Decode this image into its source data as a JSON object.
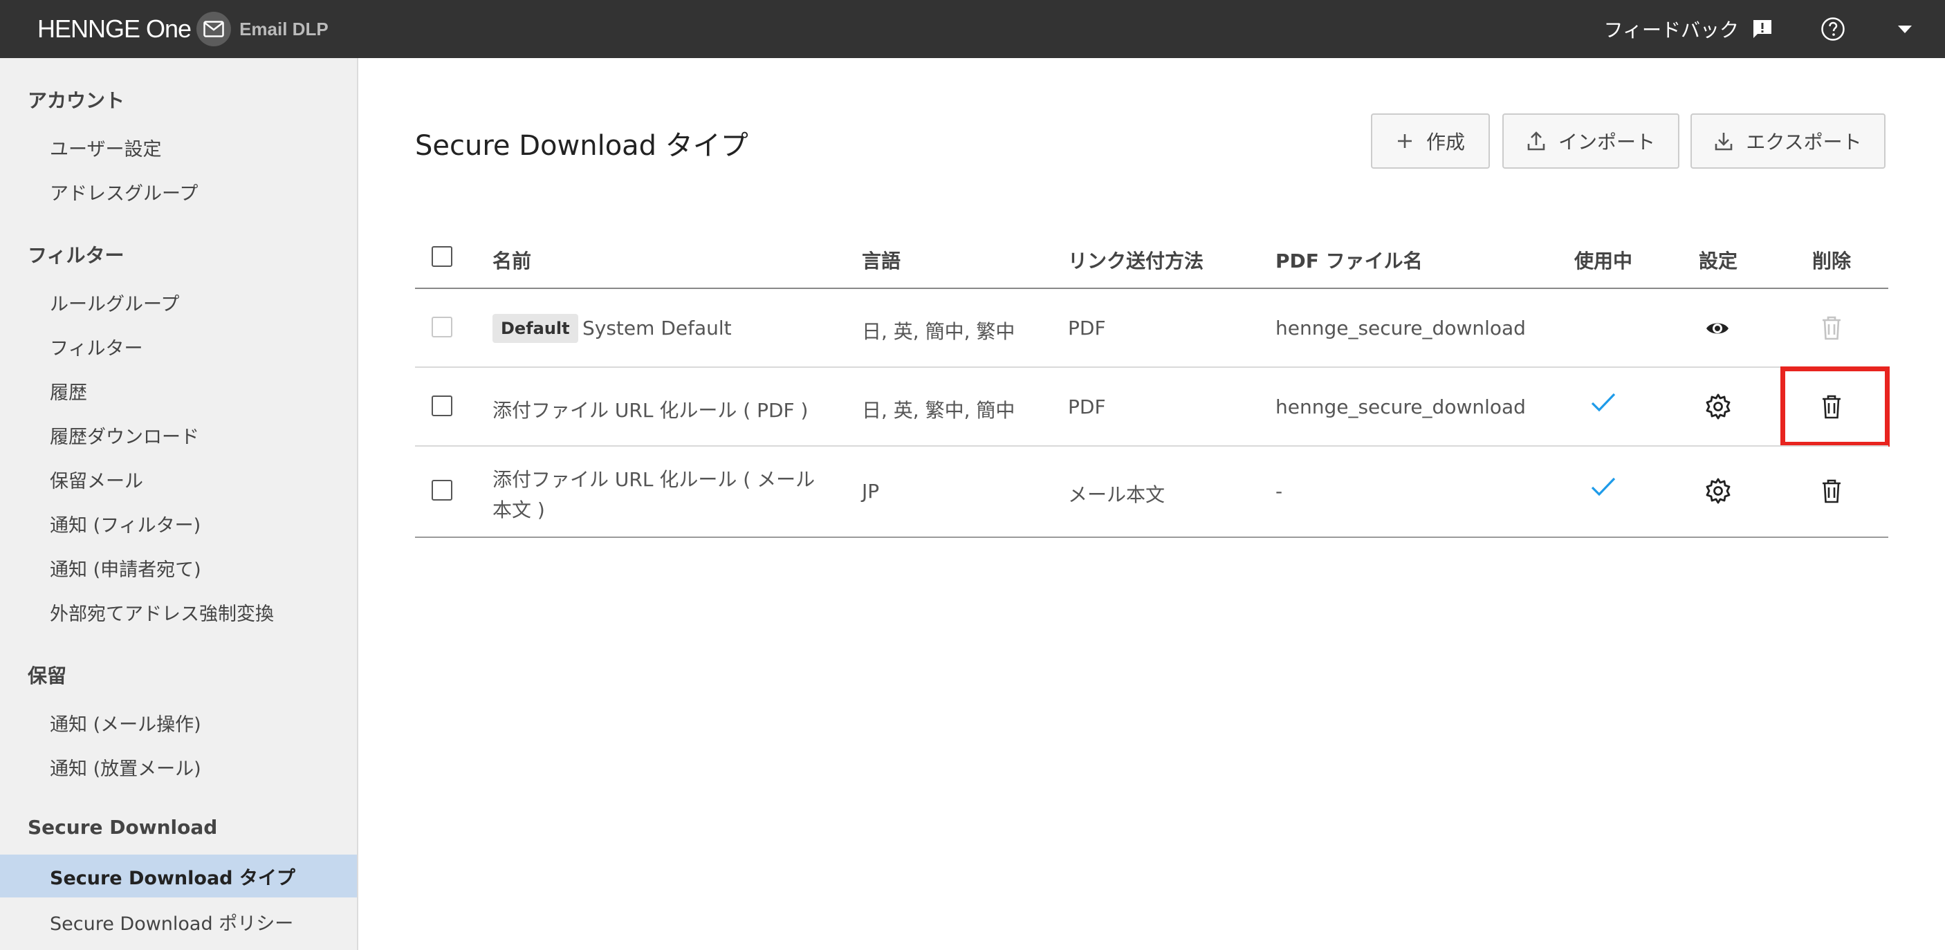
{
  "topbar": {
    "brand": "HENNGE One",
    "product": "Email DLP",
    "feedback_label": "フィードバック",
    "icons": [
      "feedback-icon",
      "help-icon",
      "caret-down-icon"
    ]
  },
  "sidebar": {
    "sections": [
      {
        "title": "アカウント",
        "items": [
          "ユーザー設定",
          "アドレスグループ"
        ]
      },
      {
        "title": "フィルター",
        "items": [
          "ルールグループ",
          "フィルター",
          "履歴",
          "履歴ダウンロード",
          "保留メール",
          "通知 (フィルター)",
          "通知 (申請者宛て)",
          "外部宛てアドレス強制変換"
        ]
      },
      {
        "title": "保留",
        "items": [
          "通知 (メール操作)",
          "通知 (放置メール)"
        ]
      },
      {
        "title": "Secure Download",
        "items": [
          "Secure Download タイプ",
          "Secure Download ポリシー"
        ]
      }
    ],
    "active_item": "Secure Download タイプ"
  },
  "main": {
    "title": "Secure Download タイプ",
    "buttons": {
      "create": "作成",
      "import": "インポート",
      "export": "エクスポート"
    },
    "table": {
      "headers": {
        "name": "名前",
        "language": "言語",
        "link_method": "リンク送付方法",
        "pdf_filename": "PDF ファイル名",
        "in_use": "使用中",
        "settings": "設定",
        "delete": "削除"
      },
      "rows": [
        {
          "badge": "Default",
          "name": "System Default",
          "language": "日, 英, 簡中, 繁中",
          "link_method": "PDF",
          "pdf_filename": "hennge_secure_download",
          "in_use": false,
          "settings_icon": "eye-icon",
          "delete_enabled": false
        },
        {
          "badge": "",
          "name": "添付ファイル URL 化ルール ( PDF )",
          "language": "日, 英, 繁中, 簡中",
          "link_method": "PDF",
          "pdf_filename": "hennge_secure_download",
          "in_use": true,
          "settings_icon": "gear-icon",
          "delete_enabled": true
        },
        {
          "badge": "",
          "name_line1": "添付ファイル URL 化ルール ( メール",
          "name_line2": "本文 )",
          "language": "JP",
          "link_method": "メール本文",
          "pdf_filename": "-",
          "in_use": true,
          "settings_icon": "gear-icon",
          "delete_enabled": true
        }
      ]
    },
    "highlight_color": "#e8241f",
    "accent_color": "#1e9be9"
  }
}
